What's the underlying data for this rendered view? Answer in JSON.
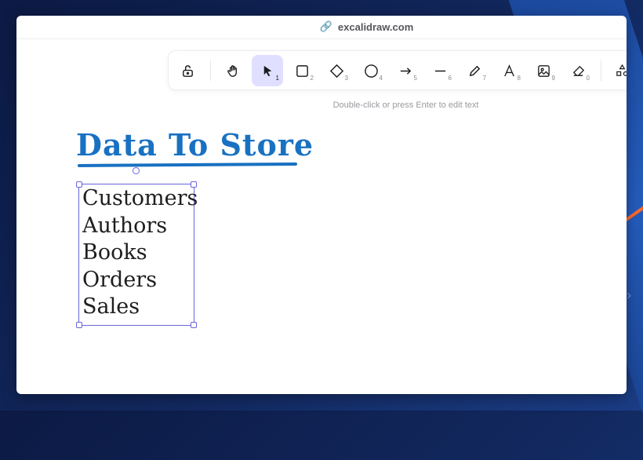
{
  "browser": {
    "url": "excalidraw.com"
  },
  "toolbar": {
    "tools": [
      {
        "name": "lock-tool",
        "num": ""
      },
      {
        "name": "hand-tool",
        "num": ""
      },
      {
        "name": "selection-tool",
        "num": "1"
      },
      {
        "name": "rectangle-tool",
        "num": "2"
      },
      {
        "name": "diamond-tool",
        "num": "3"
      },
      {
        "name": "ellipse-tool",
        "num": "4"
      },
      {
        "name": "arrow-tool",
        "num": "5"
      },
      {
        "name": "line-tool",
        "num": "6"
      },
      {
        "name": "draw-tool",
        "num": "7"
      },
      {
        "name": "text-tool",
        "num": "8"
      },
      {
        "name": "image-tool",
        "num": "9"
      },
      {
        "name": "eraser-tool",
        "num": "0"
      }
    ],
    "active_tool": "selection-tool"
  },
  "hint": "Double-click or press Enter to edit text",
  "canvas": {
    "title": "Data To Store",
    "items": [
      "Customers",
      "Authors",
      "Books",
      "Orders",
      "Sales"
    ]
  },
  "colors": {
    "title": "#1971c2",
    "selection": "#6965db",
    "active_tool_bg": "#e0dfff"
  }
}
